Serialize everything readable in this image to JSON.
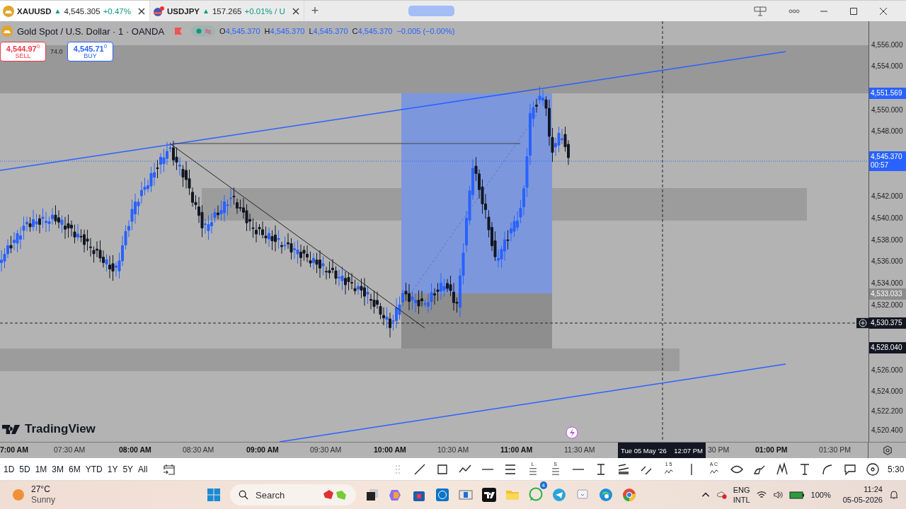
{
  "tabs": [
    {
      "symbol": "XAUUSD",
      "arrow": "▲",
      "price": "4,545.305",
      "change": "+0.47%",
      "selected": true
    },
    {
      "symbol": "USDJPY",
      "arrow": "▲",
      "price": "157.265",
      "change": "+0.01% / U",
      "selected": false
    }
  ],
  "new_tab": "+",
  "legend": {
    "title": "Gold Spot / U.S. Dollar · 1 · OANDA",
    "ohlc": [
      {
        "key": "O",
        "value": "4,545.370"
      },
      {
        "key": "H",
        "value": "4,545.370"
      },
      {
        "key": "L",
        "value": "4,545.370"
      },
      {
        "key": "C",
        "value": "4,545.370"
      }
    ],
    "change": "−0.005 (−0.00%)"
  },
  "trade": {
    "sell_price": "4,544.97",
    "sell_tail": "0",
    "sell_label": "SELL",
    "spread": "74.0",
    "buy_price": "4,545.71",
    "buy_tail": "0",
    "buy_label": "BUY"
  },
  "brand": "TradingView",
  "price_axis": [
    "4,556.000",
    "4,554.000",
    "4,550.000",
    "4,548.000",
    "4,542.000",
    "4,540.000",
    "4,538.000",
    "4,536.000",
    "4,534.000",
    "4,532.000",
    "4,526.000",
    "4,524.000",
    "4,522.200",
    "4,520.400"
  ],
  "price_tags": [
    {
      "text": "4,551.569",
      "color": "#2962ff"
    },
    {
      "text": "4,545.370",
      "sub": "00:57",
      "color": "#2962ff"
    },
    {
      "text": "4,533.033",
      "color": "#8c8c8c"
    },
    {
      "text": "4,530.375",
      "color": "#131722"
    },
    {
      "text": "4,528.040",
      "color": "#131722"
    }
  ],
  "time_axis": [
    {
      "label": "7:00 AM",
      "major": true
    },
    {
      "label": "07:30 AM",
      "major": false
    },
    {
      "label": "08:00 AM",
      "major": true
    },
    {
      "label": "08:30 AM",
      "major": false
    },
    {
      "label": "09:00 AM",
      "major": true
    },
    {
      "label": "09:30 AM",
      "major": false
    },
    {
      "label": "10:00 AM",
      "major": true
    },
    {
      "label": "10:30 AM",
      "major": false
    },
    {
      "label": "11:00 AM",
      "major": true
    },
    {
      "label": "11:30 AM",
      "major": false
    },
    {
      "label": "30 PM",
      "major": false
    },
    {
      "label": "01:00 PM",
      "major": true
    },
    {
      "label": "01:30 PM",
      "major": false
    }
  ],
  "crosshair_time": {
    "date": "Tue 05 May '26",
    "time": "12:07 PM"
  },
  "ranges": [
    "1D",
    "5D",
    "1M",
    "3M",
    "6M",
    "YTD",
    "1Y",
    "5Y",
    "All"
  ],
  "tools": [
    {
      "kind": "line"
    },
    {
      "kind": "rect"
    },
    {
      "kind": "path"
    },
    {
      "kind": "hray"
    },
    {
      "kind": "fib"
    },
    {
      "kind": "fib",
      "label": "L"
    },
    {
      "kind": "fib",
      "label": "S"
    },
    {
      "kind": "hray"
    },
    {
      "kind": "measure"
    },
    {
      "kind": "channel"
    },
    {
      "kind": "parallel"
    },
    {
      "kind": "wave",
      "label": "1 5"
    },
    {
      "kind": "vline"
    },
    {
      "kind": "wave",
      "label": "A C"
    },
    {
      "kind": "ellipse"
    },
    {
      "kind": "brush"
    },
    {
      "kind": "pattern"
    },
    {
      "kind": "text"
    },
    {
      "kind": "curve"
    },
    {
      "kind": "comment"
    },
    {
      "kind": "circle"
    }
  ],
  "toolbar_clock": "5:30",
  "taskbar": {
    "temperature": "27°C",
    "weather": "Sunny",
    "search_placeholder": "Search",
    "whatsapp_badge": "4",
    "language": "ENG",
    "layout": "INTL",
    "battery": "100%",
    "time": "11:24",
    "date": "05-05-2026"
  }
}
